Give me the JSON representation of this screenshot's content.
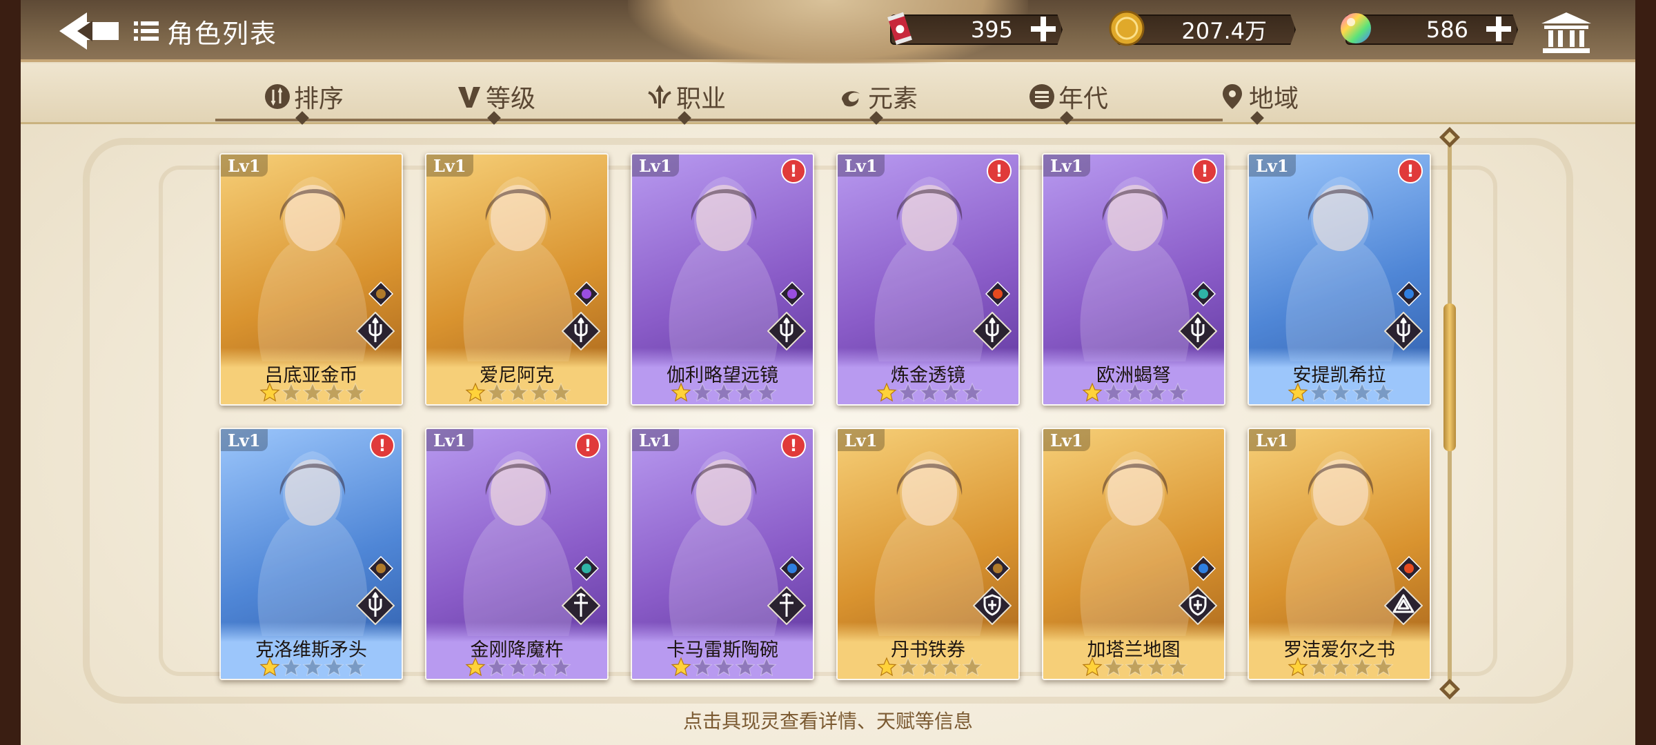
{
  "header": {
    "title": "角色列表",
    "resources": [
      {
        "icon": "soda-can-icon",
        "value": "395"
      },
      {
        "icon": "gold-coin-icon",
        "value": "207.4万"
      },
      {
        "icon": "rainbow-orb-icon",
        "value": "586"
      }
    ]
  },
  "tabs": [
    {
      "icon": "sort-icon",
      "label": "排序"
    },
    {
      "icon": "level-icon",
      "label": "等级"
    },
    {
      "icon": "class-icon",
      "label": "职业"
    },
    {
      "icon": "element-icon",
      "label": "元素"
    },
    {
      "icon": "era-icon",
      "label": "年代"
    },
    {
      "icon": "region-icon",
      "label": "地域"
    }
  ],
  "cards": [
    {
      "level": "Lv1",
      "name": "吕底亚金币",
      "tier": "gold",
      "element": "earth",
      "role": "trident",
      "alert": false,
      "stars": 1
    },
    {
      "level": "Lv1",
      "name": "爱尼阿克",
      "tier": "gold",
      "element": "thunder",
      "role": "trident",
      "alert": false,
      "stars": 1
    },
    {
      "level": "Lv1",
      "name": "伽利略望远镜",
      "tier": "purple",
      "element": "thunder",
      "role": "trident",
      "alert": true,
      "stars": 1
    },
    {
      "level": "Lv1",
      "name": "炼金透镜",
      "tier": "purple",
      "element": "fire",
      "role": "trident",
      "alert": true,
      "stars": 1
    },
    {
      "level": "Lv1",
      "name": "欧洲蝎弩",
      "tier": "purple",
      "element": "wind",
      "role": "trident",
      "alert": true,
      "stars": 1
    },
    {
      "level": "Lv1",
      "name": "安提凯希拉",
      "tier": "blue",
      "element": "water",
      "role": "trident",
      "alert": true,
      "stars": 1
    },
    {
      "level": "Lv1",
      "name": "克洛维斯矛头",
      "tier": "blue",
      "element": "earth",
      "role": "trident",
      "alert": true,
      "stars": 1
    },
    {
      "level": "Lv1",
      "name": "金刚降魔杵",
      "tier": "purple",
      "element": "wind",
      "role": "cross",
      "alert": true,
      "stars": 1
    },
    {
      "level": "Lv1",
      "name": "卡马雷斯陶碗",
      "tier": "purple",
      "element": "water",
      "role": "cross",
      "alert": true,
      "stars": 1
    },
    {
      "level": "Lv1",
      "name": "丹书铁券",
      "tier": "gold",
      "element": "earth",
      "role": "shield",
      "alert": false,
      "stars": 1
    },
    {
      "level": "Lv1",
      "name": "加塔兰地图",
      "tier": "gold",
      "element": "water",
      "role": "shield",
      "alert": false,
      "stars": 1
    },
    {
      "level": "Lv1",
      "name": "罗洁爱尔之书",
      "tier": "gold",
      "element": "fire",
      "role": "triangle",
      "alert": false,
      "stars": 1
    }
  ],
  "footer": {
    "hint": "点击具现灵查看详情、天赋等信息"
  },
  "colors": {
    "gold": "#d9932f",
    "purple": "#8a5cc8",
    "blue": "#4f86d6",
    "alert": "#e03a3a",
    "accent": "#8a7050"
  }
}
